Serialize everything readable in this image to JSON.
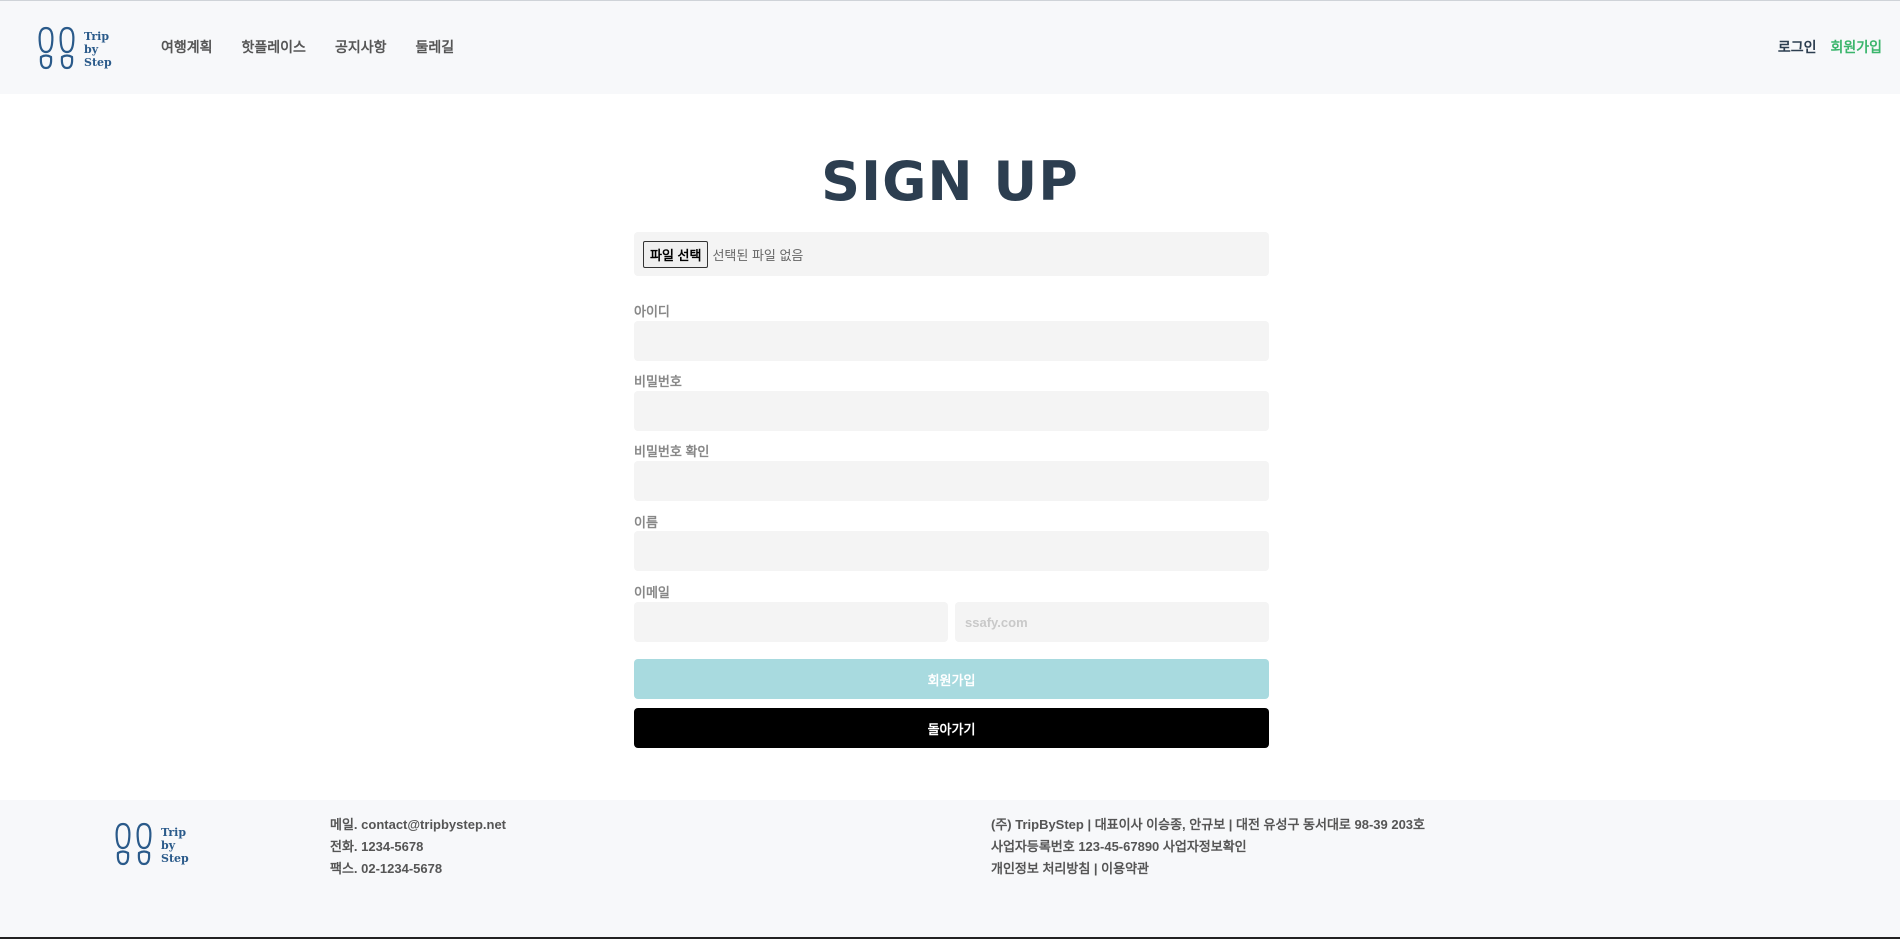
{
  "brand": {
    "logo_line1": "Trip",
    "logo_line2": "by",
    "logo_line3": "Step"
  },
  "nav": {
    "items": [
      "여행계획",
      "핫플레이스",
      "공지사항",
      "둘레길"
    ]
  },
  "auth": {
    "login": "로그인",
    "signup": "회원가입"
  },
  "page": {
    "title": "SIGN UP"
  },
  "form": {
    "file_button": "파일 선택",
    "file_status": "선택된 파일 없음",
    "id_label": "아이디",
    "password_label": "비밀번호",
    "password_confirm_label": "비밀번호 확인",
    "name_label": "이름",
    "email_label": "이메일",
    "email_domain_placeholder": "ssafy.com",
    "submit_label": "회원가입",
    "back_label": "돌아가기"
  },
  "footer": {
    "email": "메일. contact@tripbystep.net",
    "phone": "전화. 1234-5678",
    "fax": "팩스. 02-1234-5678",
    "company": "(주) TripByStep | 대표이사 이승종, 안규보 | 대전 유성구 동서대로 98-39 203호",
    "business_no": "사업자등록번호 123-45-67890 사업자정보확인",
    "policy": "개인정보 처리방침 | 이용약관"
  },
  "colors": {
    "title": "#2c3e50",
    "signup_link": "#3ab56c",
    "submit_bg": "#a8dadf",
    "back_bg": "#000000"
  }
}
